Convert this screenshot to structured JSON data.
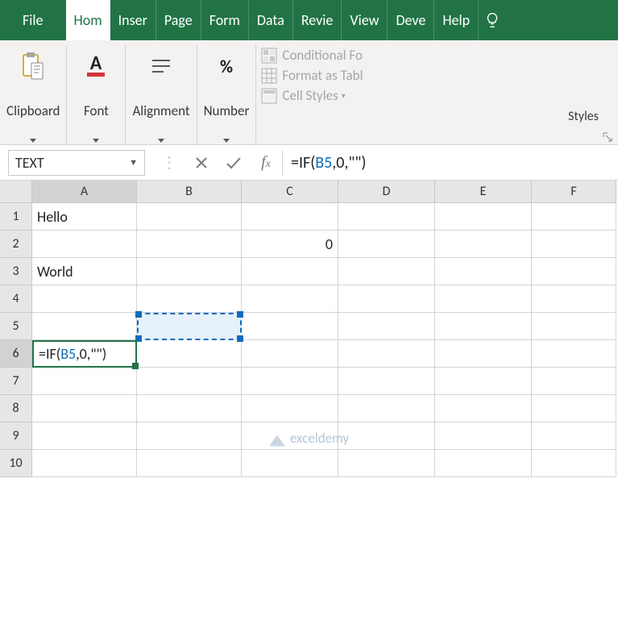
{
  "tabs": {
    "file": "File",
    "home": "Hom",
    "insert": "Inser",
    "page": "Page",
    "formulas": "Form",
    "data": "Data",
    "review": "Revie",
    "view": "View",
    "developer": "Deve",
    "help": "Help"
  },
  "ribbon": {
    "clipboard": "Clipboard",
    "font": "Font",
    "alignment": "Alignment",
    "number": "Number",
    "number_symbol": "%",
    "cond_format": "Conditional Fo",
    "format_table": "Format as Tabl",
    "cell_styles": "Cell Styles",
    "styles_label": "Styles"
  },
  "formulabar": {
    "namebox": "TEXT",
    "formula_pre": "=IF(",
    "formula_ref": "B5",
    "formula_post": ",0,\"\")"
  },
  "columns": [
    "A",
    "B",
    "C",
    "D",
    "E",
    "F"
  ],
  "rows": [
    "1",
    "2",
    "3",
    "4",
    "5",
    "6",
    "7",
    "8",
    "9",
    "10"
  ],
  "cells": {
    "A1": "Hello",
    "C2": "0",
    "A3": "World",
    "A6_pre": "=IF(",
    "A6_ref": "B5",
    "A6_post": ",0,\"\")"
  },
  "chart_data": {
    "type": "table",
    "columns": [
      "A",
      "B",
      "C",
      "D",
      "E",
      "F"
    ],
    "rows": [
      {
        "r": 1,
        "A": "Hello"
      },
      {
        "r": 2,
        "C": 0
      },
      {
        "r": 3,
        "A": "World"
      },
      {
        "r": 4
      },
      {
        "r": 5
      },
      {
        "r": 6,
        "A": "=IF(B5,0,\"\")"
      },
      {
        "r": 7
      },
      {
        "r": 8
      },
      {
        "r": 9
      },
      {
        "r": 10
      }
    ],
    "active_cell": "A6",
    "referenced_cell": "B5",
    "formula_bar": "=IF(B5,0,\"\")"
  },
  "watermark": "exceldemy"
}
